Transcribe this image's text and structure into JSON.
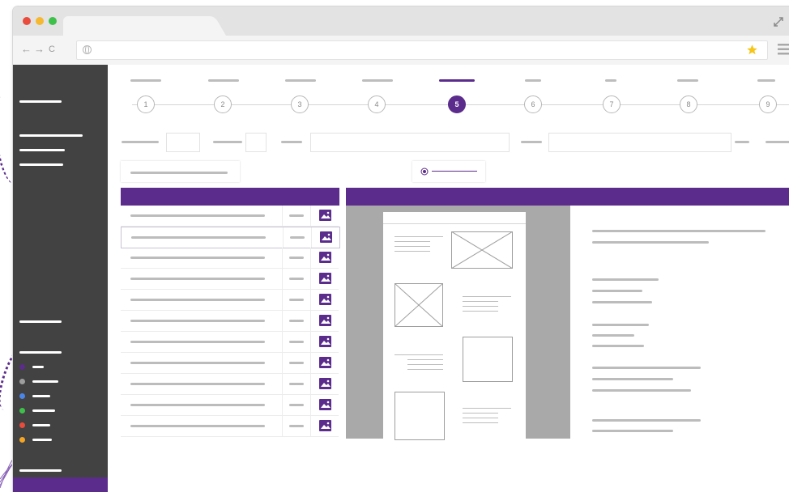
{
  "browser": {
    "nav_back": "←",
    "nav_forward": "→",
    "nav_reload": "C",
    "address": "",
    "colors": {
      "close": "#e94b3c",
      "minimize": "#f5b82e",
      "maximize": "#3ec14a",
      "star": "#f5c518"
    }
  },
  "steps": [
    {
      "number": "1"
    },
    {
      "number": "2"
    },
    {
      "number": "3"
    },
    {
      "number": "4"
    },
    {
      "number": "5",
      "active": true
    },
    {
      "number": "6"
    },
    {
      "number": "7"
    },
    {
      "number": "8"
    },
    {
      "number": "9"
    }
  ],
  "sidebar": {
    "status_colors": [
      "#5b2c8c",
      "#9e9e9e",
      "#4a86e8",
      "#3ec14a",
      "#e94b3c",
      "#f5a524"
    ]
  },
  "table": {
    "row_count": 11,
    "selected_row": 1
  },
  "theme": {
    "accent": "#5b2c8c",
    "sidebar_bg": "#424242"
  }
}
